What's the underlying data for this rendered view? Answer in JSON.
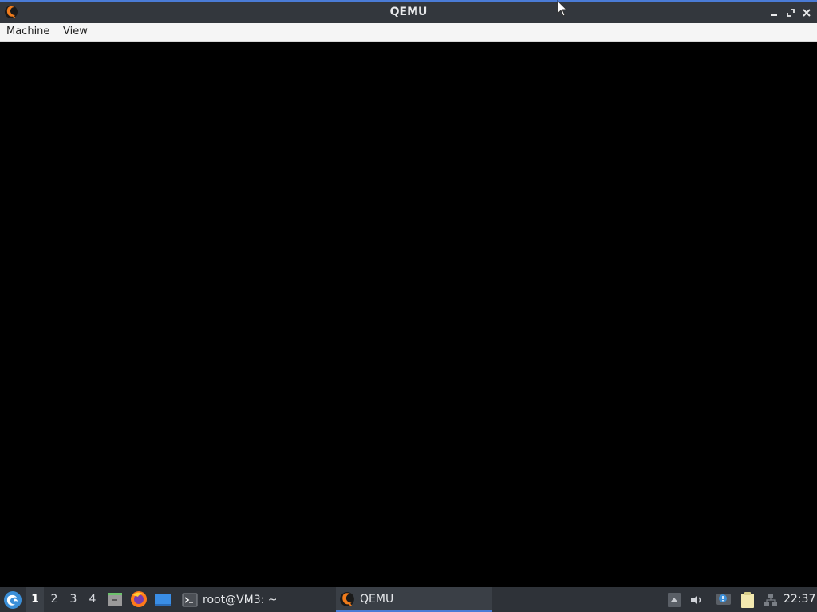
{
  "window": {
    "title": "QEMU",
    "menu": [
      "Machine",
      "View"
    ]
  },
  "taskbar": {
    "workspaces": [
      "1",
      "2",
      "3",
      "4"
    ],
    "active_workspace": "1",
    "launchers": [
      "file-manager-icon",
      "firefox-icon",
      "show-desktop-icon"
    ],
    "tasks": [
      {
        "label": "root@VM3: ~",
        "icon": "terminal-icon"
      },
      {
        "label": "QEMU",
        "icon": "qemu-icon",
        "active": true
      }
    ],
    "tray_icons": [
      "tray-arrow-icon",
      "volume-icon",
      "notification-icon",
      "clipboard-icon",
      "network-icon"
    ],
    "clock": "22:37"
  },
  "colors": {
    "titlebar": "#33373d",
    "accent": "#4a7bd6",
    "menubar": "#f5f5f5",
    "display": "#000000",
    "taskbar": "#2e3238"
  }
}
